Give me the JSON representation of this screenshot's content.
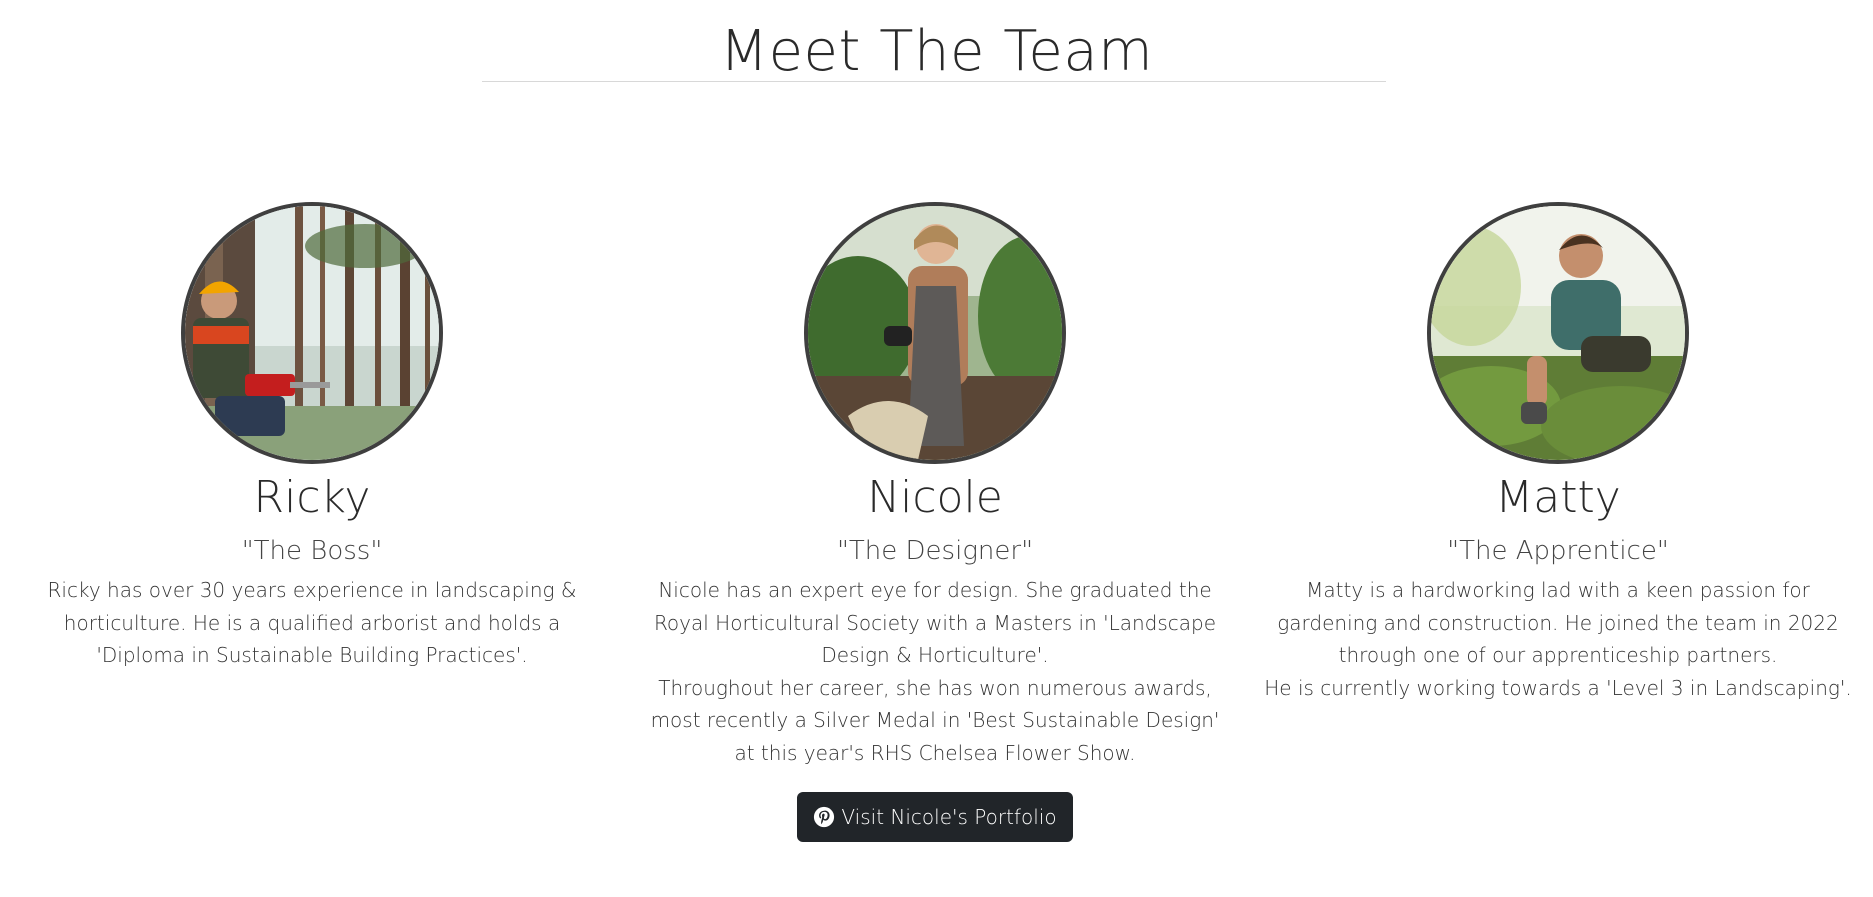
{
  "section": {
    "title": "Meet The Team"
  },
  "members": [
    {
      "name": "Ricky",
      "role": "\"The Boss\"",
      "bio": [
        "Ricky has over 30 years experience in landscaping & horticulture. He is a qualified arborist and holds a 'Diploma in Sustainable Building Practices'."
      ],
      "photo_icon": "person-arborist-photo"
    },
    {
      "name": "Nicole",
      "role": "\"The Designer\"",
      "bio": [
        "Nicole has an expert eye for design. She graduated the Royal Horticultural Society with a Masters in 'Landscape Design & Horticulture'.",
        "Throughout her career, she has won numerous awards, most recently a Silver Medal in 'Best Sustainable Design' at this year's RHS Chelsea Flower Show."
      ],
      "button_label": "Visit Nicole's Portfolio",
      "button_icon": "pinterest-icon",
      "photo_icon": "person-gardener-photo"
    },
    {
      "name": "Matty",
      "role": "\"The Apprentice\"",
      "bio": [
        "Matty is a hardworking lad with a keen passion for gardening and construction. He joined the team in 2022 through one of our apprenticeship partners.",
        "He is currently working towards a 'Level 3 in Landscaping'."
      ],
      "photo_icon": "person-apprentice-photo"
    }
  ],
  "colors": {
    "button_bg": "#212529",
    "avatar_border": "#3f3f3f",
    "rule": "#d8d8d8"
  }
}
